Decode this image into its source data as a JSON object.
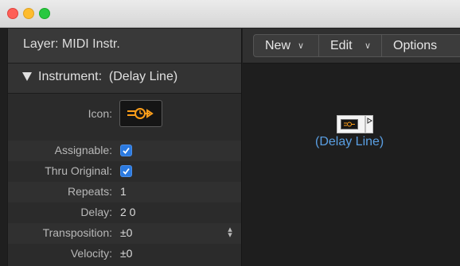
{
  "window": {
    "close_color": "#fe5f57",
    "minimize_color": "#febc2e",
    "zoom_color": "#28c840"
  },
  "inspector": {
    "layer": "Layer: MIDI Instr.",
    "instrument": "Instrument:  (Delay Line)",
    "params": [
      {
        "label": "Icon:",
        "kind": "icon",
        "icon": "delay-line-icon"
      },
      {
        "label": "Assignable:",
        "kind": "checkbox",
        "checked": true
      },
      {
        "label": "Thru Original:",
        "kind": "checkbox",
        "checked": true
      },
      {
        "label": "Repeats:",
        "kind": "text",
        "value": "1"
      },
      {
        "label": "Delay:",
        "kind": "text",
        "value": "2 0"
      },
      {
        "label": "Transposition:",
        "kind": "stepper",
        "value": "±0"
      },
      {
        "label": "Velocity:",
        "kind": "text",
        "value": "±0"
      }
    ]
  },
  "toolbar": {
    "menus": [
      "New",
      "Edit",
      "Options"
    ]
  },
  "canvas": {
    "node_label": "(Delay Line)",
    "accent": "#5a9fe3"
  }
}
